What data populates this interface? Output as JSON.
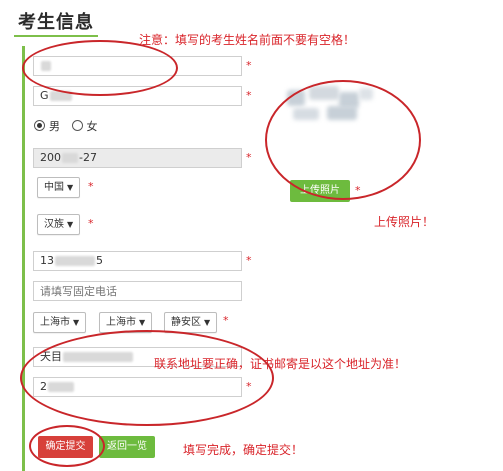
{
  "page": {
    "title": "考生信息"
  },
  "form": {
    "name_value": "",
    "pinyin_value": "G",
    "gender": {
      "male_label": "男",
      "female_label": "女",
      "selected": "男"
    },
    "birthdate_prefix": "200",
    "birthdate_suffix": "-27",
    "country": "中国",
    "ethnicity": "汉族",
    "mobile_prefix": "13",
    "mobile_suffix": "5",
    "phone_placeholder": "请填写固定电话",
    "province": "上海市",
    "city": "上海市",
    "district": "静安区",
    "address_prefix": "天目",
    "postcode_prefix": "2",
    "required_mark": "*"
  },
  "photo": {
    "upload_label": "上传照片"
  },
  "buttons": {
    "submit_label": "确定提交",
    "back_label": "返回一览"
  },
  "annotations": {
    "name_note": "注意：填写的考生姓名前面不要有空格！",
    "photo_note": "上传照片！",
    "address_note": "联系地址要正确，证书邮寄是以这个地址为准！",
    "submit_note": "填写完成，确定提交！"
  },
  "colors": {
    "accent_green": "#6dbb3e",
    "annotation_red": "#d9242a",
    "submit_red": "#d7403a"
  }
}
